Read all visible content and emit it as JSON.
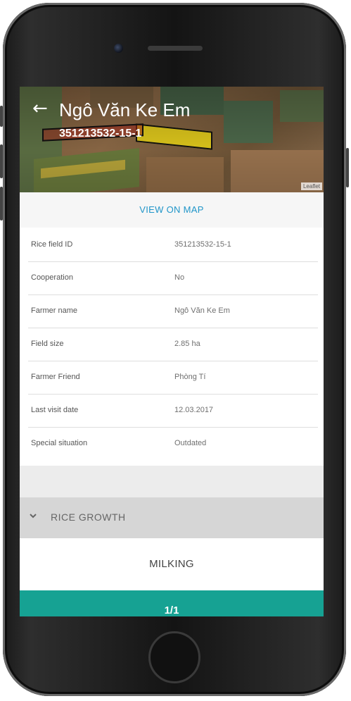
{
  "header": {
    "back_icon": "arrow-back-icon",
    "title": "Ngô Văn Ke Em",
    "subtitle": "351213532-15-1",
    "attribution": "Leaflet"
  },
  "view_on_map": "VIEW ON MAP",
  "details": [
    {
      "label": "Rice field ID",
      "value": "351213532-15-1"
    },
    {
      "label": "Cooperation",
      "value": "No"
    },
    {
      "label": "Farmer name",
      "value": "Ngô Văn Ke Em"
    },
    {
      "label": "Field size",
      "value": "2.85 ha"
    },
    {
      "label": "Farmer Friend",
      "value": "Phòng Tí"
    },
    {
      "label": "Last visit date",
      "value": "12.03.2017"
    },
    {
      "label": "Special situation",
      "value": "Outdated"
    }
  ],
  "rice_growth": {
    "icon": "chevron-down-icon",
    "label": "RICE GROWTH",
    "stage": "MILKING",
    "pager": "1/1"
  },
  "colors": {
    "accent_link": "#2196c9",
    "pager_bg": "#16a293",
    "section_bg": "#d6d6d6",
    "highlight_field": "#e0c91c"
  }
}
